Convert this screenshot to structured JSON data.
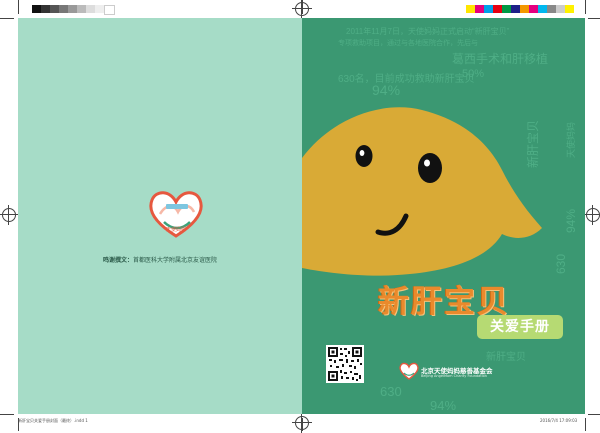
{
  "back_cover": {
    "logo_text": "天使妈妈",
    "thanks_label": "鸣谢撰文：",
    "thanks_org": "首都医科大学附属北京友谊医院"
  },
  "front_cover": {
    "title": "新肝宝贝",
    "subtitle": "关爱手册",
    "bg_lines": [
      "2011年11月7日，天使妈妈正式启动“新肝宝贝”",
      "专项救助项目，通过与各地医院合作，先后与",
      "葛西手术和肝移植",
      "630名，目前成功救助新肝宝贝",
      "50%",
      "94%"
    ],
    "side_lines": [
      "新肝宝贝",
      "天使妈妈",
      "94%",
      "630"
    ],
    "foundation_cn": "北京天使妈妈慈善基金会",
    "foundation_en": "Beijing AngelMom Charity Foundation"
  },
  "print_footer": {
    "left": "新肝宝贝关爱手册封面（最终）.indd   1",
    "right": "2016/7/4   17:09:03"
  },
  "colors": {
    "back_bg": "#a6dcc7",
    "front_bg": "#3b9872",
    "mascot": "#d9aa36",
    "title": "#e98a2c",
    "subtitle_bg": "#b6da73"
  },
  "icons": [
    "heart-logo-icon",
    "qr-code-icon",
    "mascot-liver"
  ]
}
